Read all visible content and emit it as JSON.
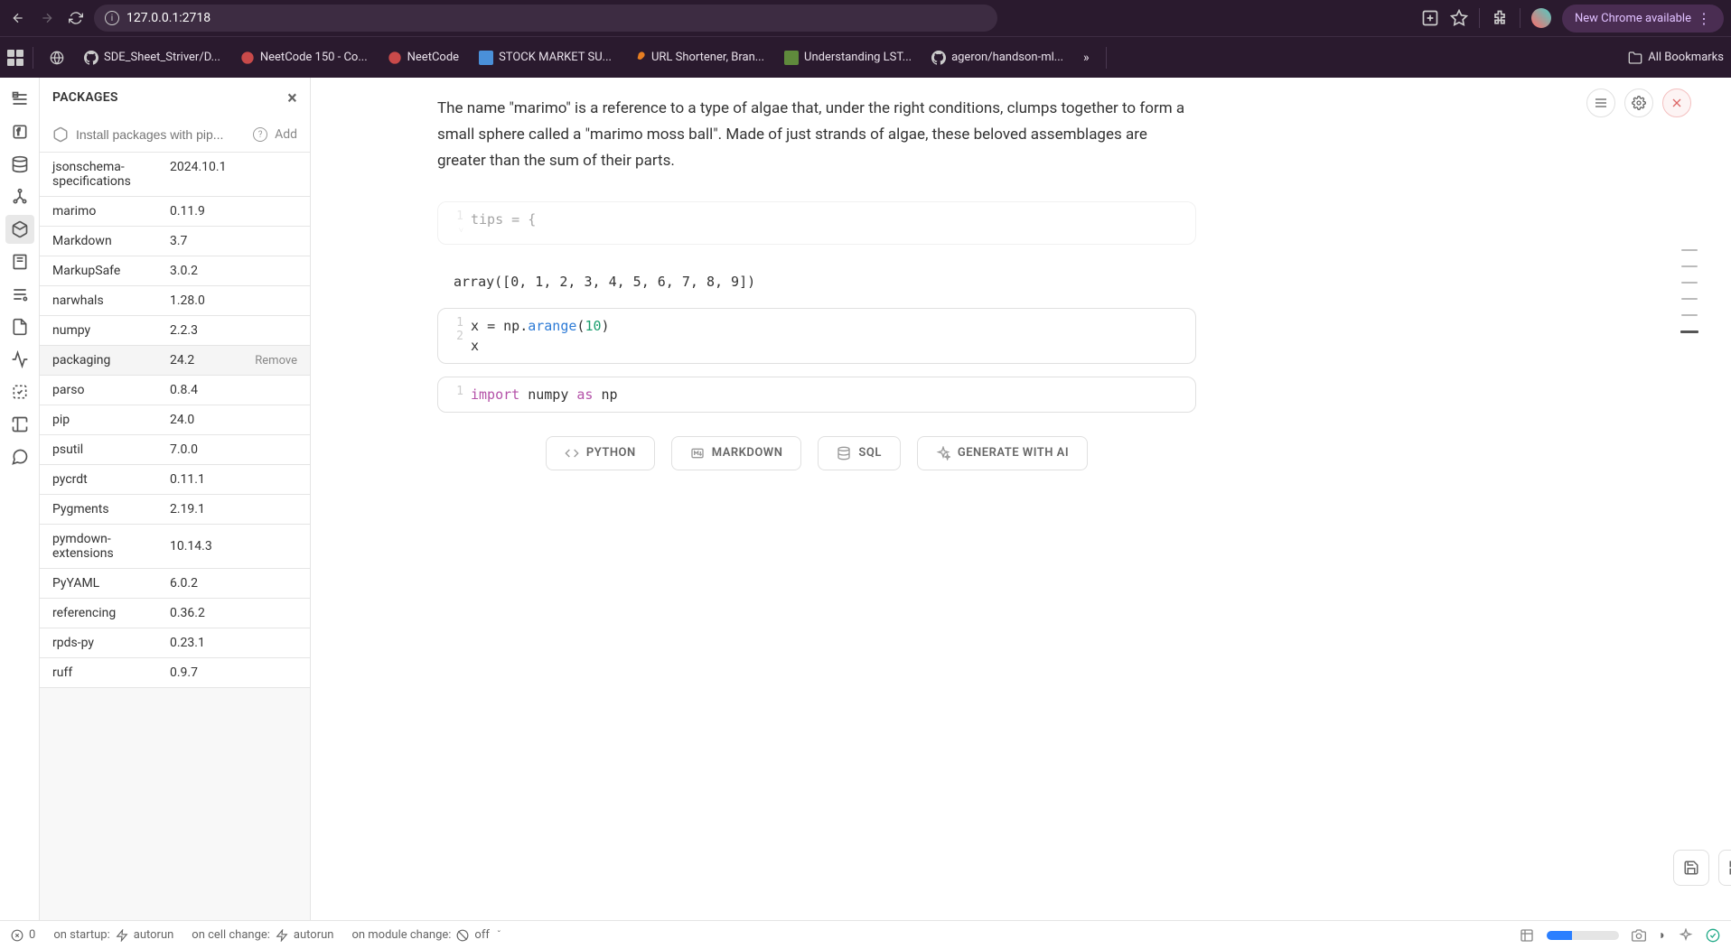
{
  "browser": {
    "url": "127.0.0.1:2718",
    "new_chrome": "New Chrome available"
  },
  "bookmarks": [
    {
      "label": "SDE_Sheet_Striver/D...",
      "icon": "github"
    },
    {
      "label": "NeetCode 150 - Co...",
      "icon": "neet"
    },
    {
      "label": "NeetCode",
      "icon": "neet"
    },
    {
      "label": "STOCK MARKET SU...",
      "icon": "doc"
    },
    {
      "label": "URL Shortener, Bran...",
      "icon": "link"
    },
    {
      "label": "Understanding LST...",
      "icon": "web"
    },
    {
      "label": "ageron/handson-ml...",
      "icon": "github"
    }
  ],
  "all_bookmarks": "All Bookmarks",
  "packages_panel": {
    "title": "PACKAGES",
    "install_placeholder": "Install packages with pip...",
    "add_label": "Add",
    "remove_label": "Remove",
    "packages": [
      {
        "name": "jsonschema-specifications",
        "version": "2024.10.1"
      },
      {
        "name": "marimo",
        "version": "0.11.9"
      },
      {
        "name": "Markdown",
        "version": "3.7"
      },
      {
        "name": "MarkupSafe",
        "version": "3.0.2"
      },
      {
        "name": "narwhals",
        "version": "1.28.0"
      },
      {
        "name": "numpy",
        "version": "2.2.3"
      },
      {
        "name": "packaging",
        "version": "24.2"
      },
      {
        "name": "parso",
        "version": "0.8.4"
      },
      {
        "name": "pip",
        "version": "24.0"
      },
      {
        "name": "psutil",
        "version": "7.0.0"
      },
      {
        "name": "pycrdt",
        "version": "0.11.1"
      },
      {
        "name": "Pygments",
        "version": "2.19.1"
      },
      {
        "name": "pymdown-extensions",
        "version": "10.14.3"
      },
      {
        "name": "PyYAML",
        "version": "6.0.2"
      },
      {
        "name": "referencing",
        "version": "0.36.2"
      },
      {
        "name": "rpds-py",
        "version": "0.23.1"
      },
      {
        "name": "ruff",
        "version": "0.9.7"
      }
    ]
  },
  "content": {
    "prose": "The name \"marimo\" is a reference to a type of algae that, under the right conditions, clumps together to form a small sphere called a \"marimo moss ball\". Made of just strands of algae, these beloved assemblages are greater than the sum of their parts.",
    "cell1": "tips = {",
    "output": "array([0, 1, 2, 3, 4, 5, 6, 7, 8, 9])",
    "cell2_line1": "x = np.arange(10)",
    "cell2_line2": "x",
    "cell3": "import numpy as np"
  },
  "add_buttons": {
    "python": "PYTHON",
    "markdown": "MARKDOWN",
    "sql": "SQL",
    "ai": "GENERATE WITH AI"
  },
  "status": {
    "errors": "0",
    "startup_label": "on startup:",
    "startup_value": "autorun",
    "cell_change_label": "on cell change:",
    "cell_change_value": "autorun",
    "module_change_label": "on module change:",
    "module_change_value": "off"
  }
}
